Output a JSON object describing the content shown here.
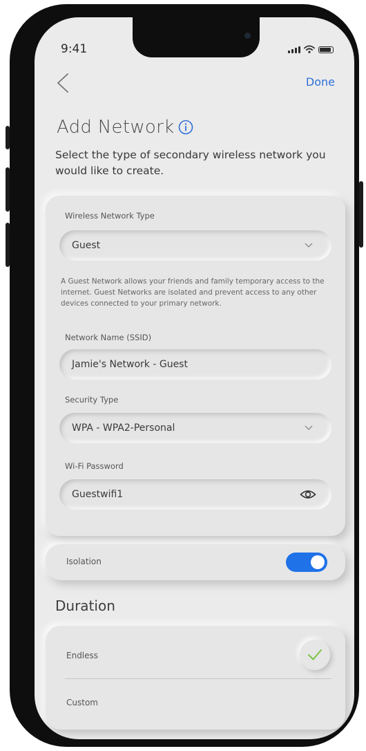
{
  "status_bar": {
    "time": "9:41"
  },
  "nav": {
    "done_label": "Done"
  },
  "header": {
    "title": "Add Network",
    "subtitle": "Select the type of secondary wireless network you would like to create."
  },
  "form": {
    "network_type": {
      "label": "Wireless Network Type",
      "value": "Guest",
      "description": "A Guest Network allows your friends and family temporary access to the internet. Guest Networks are isolated and prevent access to any other devices connected to your primary network."
    },
    "network_name": {
      "label": "Network Name (SSID)",
      "value": "Jamie's Network - Guest"
    },
    "security_type": {
      "label": "Security Type",
      "value": "WPA - WPA2-Personal"
    },
    "password": {
      "label": "Wi-Fi Password",
      "value": "Guestwifi1"
    }
  },
  "isolation": {
    "label": "Isolation",
    "enabled": true
  },
  "duration": {
    "title": "Duration",
    "options": [
      {
        "label": "Endless",
        "selected": true
      },
      {
        "label": "Custom",
        "selected": false
      }
    ]
  },
  "colors": {
    "accent": "#2f6fd8",
    "toggle_on": "#1f72e8",
    "check": "#7cc242",
    "background": "#ebebeb"
  },
  "icons": [
    "back-chevron-icon",
    "info-icon",
    "chevron-down-icon",
    "eye-icon",
    "check-icon",
    "signal-icon",
    "wifi-icon",
    "battery-icon"
  ]
}
